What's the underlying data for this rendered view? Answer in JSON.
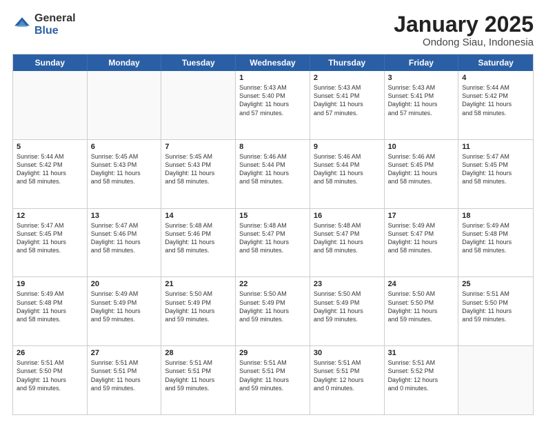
{
  "logo": {
    "general": "General",
    "blue": "Blue"
  },
  "title": "January 2025",
  "subtitle": "Ondong Siau, Indonesia",
  "days": [
    "Sunday",
    "Monday",
    "Tuesday",
    "Wednesday",
    "Thursday",
    "Friday",
    "Saturday"
  ],
  "rows": [
    [
      {
        "num": "",
        "lines": [],
        "empty": true
      },
      {
        "num": "",
        "lines": [],
        "empty": true
      },
      {
        "num": "",
        "lines": [],
        "empty": true
      },
      {
        "num": "1",
        "lines": [
          "Sunrise: 5:43 AM",
          "Sunset: 5:40 PM",
          "Daylight: 11 hours",
          "and 57 minutes."
        ]
      },
      {
        "num": "2",
        "lines": [
          "Sunrise: 5:43 AM",
          "Sunset: 5:41 PM",
          "Daylight: 11 hours",
          "and 57 minutes."
        ]
      },
      {
        "num": "3",
        "lines": [
          "Sunrise: 5:43 AM",
          "Sunset: 5:41 PM",
          "Daylight: 11 hours",
          "and 57 minutes."
        ]
      },
      {
        "num": "4",
        "lines": [
          "Sunrise: 5:44 AM",
          "Sunset: 5:42 PM",
          "Daylight: 11 hours",
          "and 58 minutes."
        ]
      }
    ],
    [
      {
        "num": "5",
        "lines": [
          "Sunrise: 5:44 AM",
          "Sunset: 5:42 PM",
          "Daylight: 11 hours",
          "and 58 minutes."
        ]
      },
      {
        "num": "6",
        "lines": [
          "Sunrise: 5:45 AM",
          "Sunset: 5:43 PM",
          "Daylight: 11 hours",
          "and 58 minutes."
        ]
      },
      {
        "num": "7",
        "lines": [
          "Sunrise: 5:45 AM",
          "Sunset: 5:43 PM",
          "Daylight: 11 hours",
          "and 58 minutes."
        ]
      },
      {
        "num": "8",
        "lines": [
          "Sunrise: 5:46 AM",
          "Sunset: 5:44 PM",
          "Daylight: 11 hours",
          "and 58 minutes."
        ]
      },
      {
        "num": "9",
        "lines": [
          "Sunrise: 5:46 AM",
          "Sunset: 5:44 PM",
          "Daylight: 11 hours",
          "and 58 minutes."
        ]
      },
      {
        "num": "10",
        "lines": [
          "Sunrise: 5:46 AM",
          "Sunset: 5:45 PM",
          "Daylight: 11 hours",
          "and 58 minutes."
        ]
      },
      {
        "num": "11",
        "lines": [
          "Sunrise: 5:47 AM",
          "Sunset: 5:45 PM",
          "Daylight: 11 hours",
          "and 58 minutes."
        ]
      }
    ],
    [
      {
        "num": "12",
        "lines": [
          "Sunrise: 5:47 AM",
          "Sunset: 5:45 PM",
          "Daylight: 11 hours",
          "and 58 minutes."
        ]
      },
      {
        "num": "13",
        "lines": [
          "Sunrise: 5:47 AM",
          "Sunset: 5:46 PM",
          "Daylight: 11 hours",
          "and 58 minutes."
        ]
      },
      {
        "num": "14",
        "lines": [
          "Sunrise: 5:48 AM",
          "Sunset: 5:46 PM",
          "Daylight: 11 hours",
          "and 58 minutes."
        ]
      },
      {
        "num": "15",
        "lines": [
          "Sunrise: 5:48 AM",
          "Sunset: 5:47 PM",
          "Daylight: 11 hours",
          "and 58 minutes."
        ]
      },
      {
        "num": "16",
        "lines": [
          "Sunrise: 5:48 AM",
          "Sunset: 5:47 PM",
          "Daylight: 11 hours",
          "and 58 minutes."
        ]
      },
      {
        "num": "17",
        "lines": [
          "Sunrise: 5:49 AM",
          "Sunset: 5:47 PM",
          "Daylight: 11 hours",
          "and 58 minutes."
        ]
      },
      {
        "num": "18",
        "lines": [
          "Sunrise: 5:49 AM",
          "Sunset: 5:48 PM",
          "Daylight: 11 hours",
          "and 58 minutes."
        ]
      }
    ],
    [
      {
        "num": "19",
        "lines": [
          "Sunrise: 5:49 AM",
          "Sunset: 5:48 PM",
          "Daylight: 11 hours",
          "and 58 minutes."
        ]
      },
      {
        "num": "20",
        "lines": [
          "Sunrise: 5:49 AM",
          "Sunset: 5:49 PM",
          "Daylight: 11 hours",
          "and 59 minutes."
        ]
      },
      {
        "num": "21",
        "lines": [
          "Sunrise: 5:50 AM",
          "Sunset: 5:49 PM",
          "Daylight: 11 hours",
          "and 59 minutes."
        ]
      },
      {
        "num": "22",
        "lines": [
          "Sunrise: 5:50 AM",
          "Sunset: 5:49 PM",
          "Daylight: 11 hours",
          "and 59 minutes."
        ]
      },
      {
        "num": "23",
        "lines": [
          "Sunrise: 5:50 AM",
          "Sunset: 5:49 PM",
          "Daylight: 11 hours",
          "and 59 minutes."
        ]
      },
      {
        "num": "24",
        "lines": [
          "Sunrise: 5:50 AM",
          "Sunset: 5:50 PM",
          "Daylight: 11 hours",
          "and 59 minutes."
        ]
      },
      {
        "num": "25",
        "lines": [
          "Sunrise: 5:51 AM",
          "Sunset: 5:50 PM",
          "Daylight: 11 hours",
          "and 59 minutes."
        ]
      }
    ],
    [
      {
        "num": "26",
        "lines": [
          "Sunrise: 5:51 AM",
          "Sunset: 5:50 PM",
          "Daylight: 11 hours",
          "and 59 minutes."
        ]
      },
      {
        "num": "27",
        "lines": [
          "Sunrise: 5:51 AM",
          "Sunset: 5:51 PM",
          "Daylight: 11 hours",
          "and 59 minutes."
        ]
      },
      {
        "num": "28",
        "lines": [
          "Sunrise: 5:51 AM",
          "Sunset: 5:51 PM",
          "Daylight: 11 hours",
          "and 59 minutes."
        ]
      },
      {
        "num": "29",
        "lines": [
          "Sunrise: 5:51 AM",
          "Sunset: 5:51 PM",
          "Daylight: 11 hours",
          "and 59 minutes."
        ]
      },
      {
        "num": "30",
        "lines": [
          "Sunrise: 5:51 AM",
          "Sunset: 5:51 PM",
          "Daylight: 12 hours",
          "and 0 minutes."
        ]
      },
      {
        "num": "31",
        "lines": [
          "Sunrise: 5:51 AM",
          "Sunset: 5:52 PM",
          "Daylight: 12 hours",
          "and 0 minutes."
        ]
      },
      {
        "num": "",
        "lines": [],
        "empty": true
      }
    ]
  ]
}
